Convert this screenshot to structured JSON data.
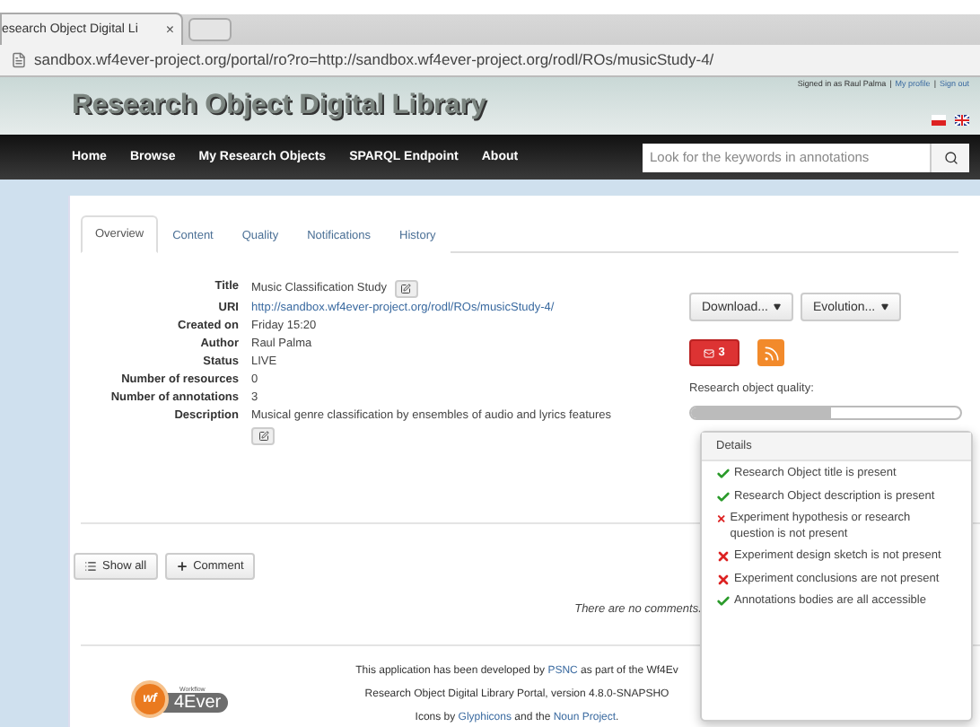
{
  "browser": {
    "tab_title": "esearch Object Digital Li",
    "tab_close": "×",
    "url": "sandbox.wf4ever-project.org/portal/ro?ro=http://sandbox.wf4ever-project.org/rodl/ROs/musicStudy-4/"
  },
  "header": {
    "title": "Research Object Digital Library",
    "signed_in": "Signed in as Raul Palma",
    "separator": "|",
    "links": [
      "My profile",
      "Sign out"
    ]
  },
  "nav": {
    "items": [
      "Home",
      "Browse",
      "My Research Objects",
      "SPARQL Endpoint",
      "About"
    ],
    "search": {
      "placeholder": "Look for the keywords in annotations"
    }
  },
  "tabs": [
    {
      "label": "Overview",
      "selected": true
    },
    {
      "label": "Content",
      "selected": false
    },
    {
      "label": "Quality",
      "selected": false
    },
    {
      "label": "Notifications",
      "selected": false
    },
    {
      "label": "History",
      "selected": false
    }
  ],
  "details": [
    {
      "label": "Title",
      "value": "Music Classification Study",
      "kind": "editable"
    },
    {
      "label": "URI",
      "value": "http://sandbox.wf4ever-project.org/rodl/ROs/musicStudy-4/",
      "kind": "link"
    },
    {
      "label": "Created on",
      "value": "Friday 15:20",
      "kind": "text"
    },
    {
      "label": "Author",
      "value": "Raul Palma",
      "kind": "text"
    },
    {
      "label": "Status",
      "value": "LIVE",
      "kind": "text"
    },
    {
      "label": "Number of resources",
      "value": "0",
      "kind": "text"
    },
    {
      "label": "Number of annotations",
      "value": "3",
      "kind": "text"
    },
    {
      "label": "Description",
      "value": "Musical genre classification by ensembles of audio and lyrics features",
      "kind": "editable-below"
    }
  ],
  "actions": {
    "buttons": [
      "Download...",
      "Evolution..."
    ],
    "messages_count": "3"
  },
  "quality": {
    "label": "Research object quality:",
    "level": 0.52,
    "popup": {
      "title": "Details",
      "checks": [
        {
          "text": "Research Object title is present",
          "passed": true
        },
        {
          "text": "Research Object description is present",
          "passed": true
        },
        {
          "text": "Experiment hypothesis or research question is not present",
          "passed": false
        },
        {
          "text": "Experiment design sketch is not present",
          "passed": false
        },
        {
          "text": "Experiment conclusions are not present",
          "passed": false
        },
        {
          "text": "Annotations bodies are all accessible",
          "passed": true
        }
      ]
    }
  },
  "comments": {
    "buttons": [
      "Show all",
      "Comment"
    ],
    "empty": "There are no comments."
  },
  "footer": {
    "logo_small": "Workflow",
    "logo_badge": "wf",
    "logo_text": "4Ever",
    "lines": [
      [
        {
          "text": "This application has been developed by "
        },
        {
          "text": "PSNC",
          "link": true
        },
        {
          "text": " as part of the Wf4Ev"
        }
      ],
      [
        {
          "text": "Research Object Digital Library Portal, version 4.8.0-SNAPSHO"
        }
      ],
      [
        {
          "text": "Icons by "
        },
        {
          "text": "Glyphicons",
          "link": true
        },
        {
          "text": " and the "
        },
        {
          "text": "Noun Project",
          "link": true
        },
        {
          "text": "."
        }
      ]
    ]
  }
}
